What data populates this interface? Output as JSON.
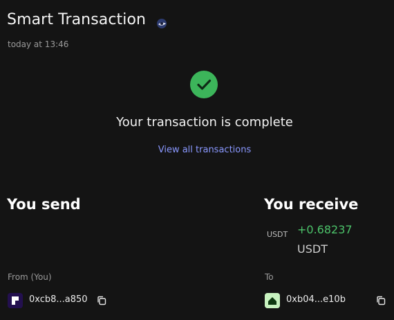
{
  "header": {
    "title": "Smart Transaction",
    "timestamp": "today at 13:46"
  },
  "status": {
    "message": "Your transaction is complete",
    "view_all_label": "View all transactions",
    "success_color": "#3cb55a"
  },
  "send": {
    "heading": "You send",
    "from_label": "From (You)",
    "address": "0xcb8...a850"
  },
  "receive": {
    "heading": "You receive",
    "token_icon_label": "USDT",
    "amount": "+0.68237",
    "symbol": "USDT",
    "to_label": "To",
    "address": "0xb04...e10b"
  },
  "colors": {
    "background": "#141414",
    "accent_link": "#8a98ff",
    "positive": "#4cc36a"
  },
  "icons": [
    "network-icon",
    "success-check-icon",
    "copy-icon",
    "from-account-avatar",
    "to-account-avatar"
  ]
}
